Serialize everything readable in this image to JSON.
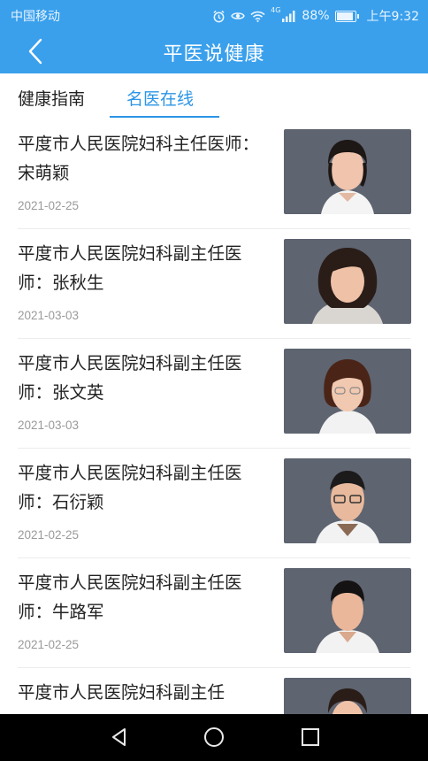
{
  "status_bar": {
    "carrier": "中国移动",
    "network": "4G",
    "battery": "88%",
    "time": "上午9:32",
    "icons": [
      "alarm-icon",
      "eye-icon",
      "wifi-icon",
      "signal-icon",
      "battery-icon"
    ]
  },
  "header": {
    "title": "平医说健康",
    "background": "#3aa0ec"
  },
  "tabs": [
    {
      "label": "健康指南",
      "active": false
    },
    {
      "label": "名医在线",
      "active": true
    }
  ],
  "accent_color": "#2b95e6",
  "articles": [
    {
      "title": "平度市人民医院妇科主任医师：宋萌颖",
      "date": "2021-02-25"
    },
    {
      "title": "平度市人民医院妇科副主任医师：张秋生",
      "date": "2021-03-03"
    },
    {
      "title": "平度市人民医院妇科副主任医师：张文英",
      "date": "2021-03-03"
    },
    {
      "title": "平度市人民医院妇科副主任医师：石衍颖",
      "date": "2021-02-25"
    },
    {
      "title": "平度市人民医院妇科副主任医师：牛路军",
      "date": "2021-02-25"
    },
    {
      "title": "平度市人民医院妇科副主任",
      "date": ""
    }
  ],
  "system_nav": [
    "back-icon",
    "home-icon",
    "recents-icon"
  ]
}
